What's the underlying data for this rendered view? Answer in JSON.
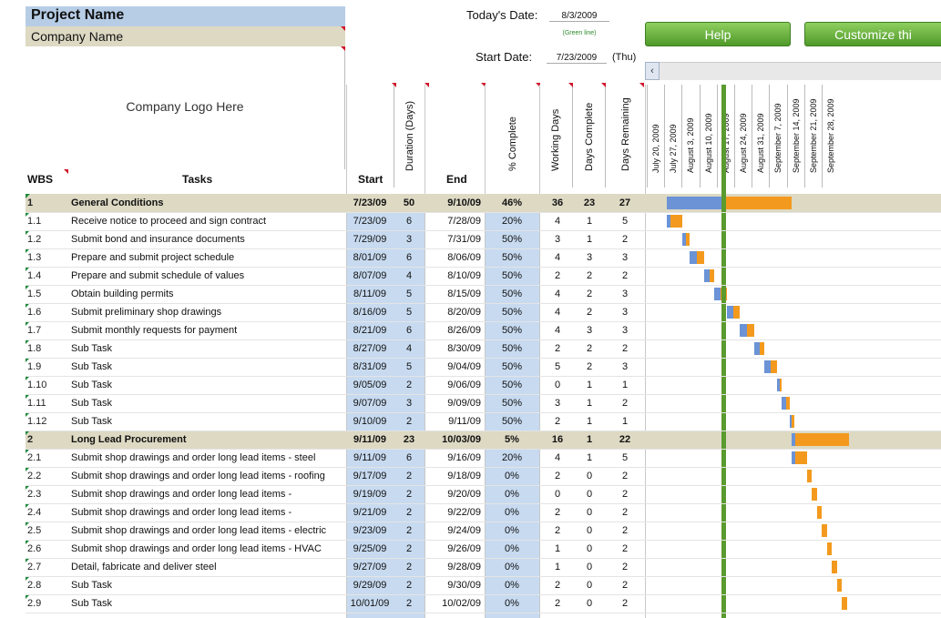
{
  "header": {
    "project_name": "Project Name",
    "company_name": "Company Name",
    "logo_placeholder": "Company Logo Here",
    "todays_date_label": "Today's Date:",
    "todays_date": "8/3/2009",
    "green_line_note": "(Green line)",
    "start_date_label": "Start Date:",
    "start_date": "7/23/2009",
    "start_day": "(Thu)"
  },
  "buttons": {
    "help": "Help",
    "customize": "Customize thi"
  },
  "scroll_left_icon": "chevron-left-icon",
  "columns": {
    "wbs": "WBS",
    "tasks": "Tasks",
    "start": "Start",
    "duration": "Duration (Days)",
    "end": "End",
    "pct_complete": "% Complete",
    "working_days": "Working Days",
    "days_complete": "Days Complete",
    "days_remaining": "Days Remaining"
  },
  "timeline": {
    "start": "2009-07-20",
    "week_labels": [
      "July 20, 2009",
      "July 27, 2009",
      "August 3, 2009",
      "August 10, 2009",
      "August 17, 2009",
      "August 24, 2009",
      "August 31, 2009",
      "September 7, 2009",
      "September 14, 2009",
      "September 21, 2009",
      "September 28, 2009"
    ],
    "today": "2009-08-03"
  },
  "colors": {
    "complete": "#6b93d6",
    "remaining": "#f39a1e",
    "today_line": "#5a9a2e",
    "summary_row": "#ddd9c3"
  },
  "rows": [
    {
      "wbs": "1",
      "task": "General Conditions",
      "start": "7/23/09",
      "dur": "50",
      "end": "9/10/09",
      "pct": "46%",
      "wd": "36",
      "dc": "23",
      "dr": "27",
      "summary": true,
      "s": "2009-07-23",
      "d": 50,
      "p": 0.46
    },
    {
      "wbs": "1.1",
      "task": "Receive notice to proceed and sign contract",
      "start": "7/23/09",
      "dur": "6",
      "end": "7/28/09",
      "pct": "20%",
      "wd": "4",
      "dc": "1",
      "dr": "5",
      "s": "2009-07-23",
      "d": 6,
      "p": 0.2
    },
    {
      "wbs": "1.2",
      "task": "Submit bond and insurance documents",
      "start": "7/29/09",
      "dur": "3",
      "end": "7/31/09",
      "pct": "50%",
      "wd": "3",
      "dc": "1",
      "dr": "2",
      "s": "2009-07-29",
      "d": 3,
      "p": 0.5
    },
    {
      "wbs": "1.3",
      "task": "Prepare and submit project schedule",
      "start": "8/01/09",
      "dur": "6",
      "end": "8/06/09",
      "pct": "50%",
      "wd": "4",
      "dc": "3",
      "dr": "3",
      "s": "2009-08-01",
      "d": 6,
      "p": 0.5
    },
    {
      "wbs": "1.4",
      "task": "Prepare and submit schedule of values",
      "start": "8/07/09",
      "dur": "4",
      "end": "8/10/09",
      "pct": "50%",
      "wd": "2",
      "dc": "2",
      "dr": "2",
      "s": "2009-08-07",
      "d": 4,
      "p": 0.5
    },
    {
      "wbs": "1.5",
      "task": "Obtain building permits",
      "start": "8/11/09",
      "dur": "5",
      "end": "8/15/09",
      "pct": "50%",
      "wd": "4",
      "dc": "2",
      "dr": "3",
      "s": "2009-08-11",
      "d": 5,
      "p": 0.5
    },
    {
      "wbs": "1.6",
      "task": "Submit preliminary shop drawings",
      "start": "8/16/09",
      "dur": "5",
      "end": "8/20/09",
      "pct": "50%",
      "wd": "4",
      "dc": "2",
      "dr": "3",
      "s": "2009-08-16",
      "d": 5,
      "p": 0.5
    },
    {
      "wbs": "1.7",
      "task": "Submit monthly requests for payment",
      "start": "8/21/09",
      "dur": "6",
      "end": "8/26/09",
      "pct": "50%",
      "wd": "4",
      "dc": "3",
      "dr": "3",
      "s": "2009-08-21",
      "d": 6,
      "p": 0.5
    },
    {
      "wbs": "1.8",
      "task": "Sub Task",
      "start": "8/27/09",
      "dur": "4",
      "end": "8/30/09",
      "pct": "50%",
      "wd": "2",
      "dc": "2",
      "dr": "2",
      "s": "2009-08-27",
      "d": 4,
      "p": 0.5
    },
    {
      "wbs": "1.9",
      "task": "Sub Task",
      "start": "8/31/09",
      "dur": "5",
      "end": "9/04/09",
      "pct": "50%",
      "wd": "5",
      "dc": "2",
      "dr": "3",
      "s": "2009-08-31",
      "d": 5,
      "p": 0.5
    },
    {
      "wbs": "1.10",
      "task": "Sub Task",
      "start": "9/05/09",
      "dur": "2",
      "end": "9/06/09",
      "pct": "50%",
      "wd": "0",
      "dc": "1",
      "dr": "1",
      "s": "2009-09-05",
      "d": 2,
      "p": 0.5
    },
    {
      "wbs": "1.11",
      "task": "Sub Task",
      "start": "9/07/09",
      "dur": "3",
      "end": "9/09/09",
      "pct": "50%",
      "wd": "3",
      "dc": "1",
      "dr": "2",
      "s": "2009-09-07",
      "d": 3,
      "p": 0.5
    },
    {
      "wbs": "1.12",
      "task": "Sub Task",
      "start": "9/10/09",
      "dur": "2",
      "end": "9/11/09",
      "pct": "50%",
      "wd": "2",
      "dc": "1",
      "dr": "1",
      "s": "2009-09-10",
      "d": 2,
      "p": 0.5
    },
    {
      "wbs": "2",
      "task": "Long Lead Procurement",
      "start": "9/11/09",
      "dur": "23",
      "end": "10/03/09",
      "pct": "5%",
      "wd": "16",
      "dc": "1",
      "dr": "22",
      "summary": true,
      "s": "2009-09-11",
      "d": 23,
      "p": 0.05
    },
    {
      "wbs": "2.1",
      "task": "Submit shop drawings and order long lead items - steel",
      "start": "9/11/09",
      "dur": "6",
      "end": "9/16/09",
      "pct": "20%",
      "wd": "4",
      "dc": "1",
      "dr": "5",
      "s": "2009-09-11",
      "d": 6,
      "p": 0.2
    },
    {
      "wbs": "2.2",
      "task": "Submit shop drawings and order long lead items - roofing",
      "start": "9/17/09",
      "dur": "2",
      "end": "9/18/09",
      "pct": "0%",
      "wd": "2",
      "dc": "0",
      "dr": "2",
      "s": "2009-09-17",
      "d": 2,
      "p": 0
    },
    {
      "wbs": "2.3",
      "task": "Submit shop drawings and order long lead items -",
      "start": "9/19/09",
      "dur": "2",
      "end": "9/20/09",
      "pct": "0%",
      "wd": "0",
      "dc": "0",
      "dr": "2",
      "s": "2009-09-19",
      "d": 2,
      "p": 0
    },
    {
      "wbs": "2.4",
      "task": "Submit shop drawings and order long lead items -",
      "start": "9/21/09",
      "dur": "2",
      "end": "9/22/09",
      "pct": "0%",
      "wd": "2",
      "dc": "0",
      "dr": "2",
      "s": "2009-09-21",
      "d": 2,
      "p": 0
    },
    {
      "wbs": "2.5",
      "task": "Submit shop drawings and order long lead items - electric",
      "start": "9/23/09",
      "dur": "2",
      "end": "9/24/09",
      "pct": "0%",
      "wd": "2",
      "dc": "0",
      "dr": "2",
      "s": "2009-09-23",
      "d": 2,
      "p": 0
    },
    {
      "wbs": "2.6",
      "task": "Submit shop drawings and order long lead items - HVAC",
      "start": "9/25/09",
      "dur": "2",
      "end": "9/26/09",
      "pct": "0%",
      "wd": "1",
      "dc": "0",
      "dr": "2",
      "s": "2009-09-25",
      "d": 2,
      "p": 0
    },
    {
      "wbs": "2.7",
      "task": "Detail, fabricate and deliver steel",
      "start": "9/27/09",
      "dur": "2",
      "end": "9/28/09",
      "pct": "0%",
      "wd": "1",
      "dc": "0",
      "dr": "2",
      "s": "2009-09-27",
      "d": 2,
      "p": 0
    },
    {
      "wbs": "2.8",
      "task": "Sub Task",
      "start": "9/29/09",
      "dur": "2",
      "end": "9/30/09",
      "pct": "0%",
      "wd": "2",
      "dc": "0",
      "dr": "2",
      "s": "2009-09-29",
      "d": 2,
      "p": 0
    },
    {
      "wbs": "2.9",
      "task": "Sub Task",
      "start": "10/01/09",
      "dur": "2",
      "end": "10/02/09",
      "pct": "0%",
      "wd": "2",
      "dc": "0",
      "dr": "2",
      "s": "2009-10-01",
      "d": 2,
      "p": 0
    }
  ]
}
